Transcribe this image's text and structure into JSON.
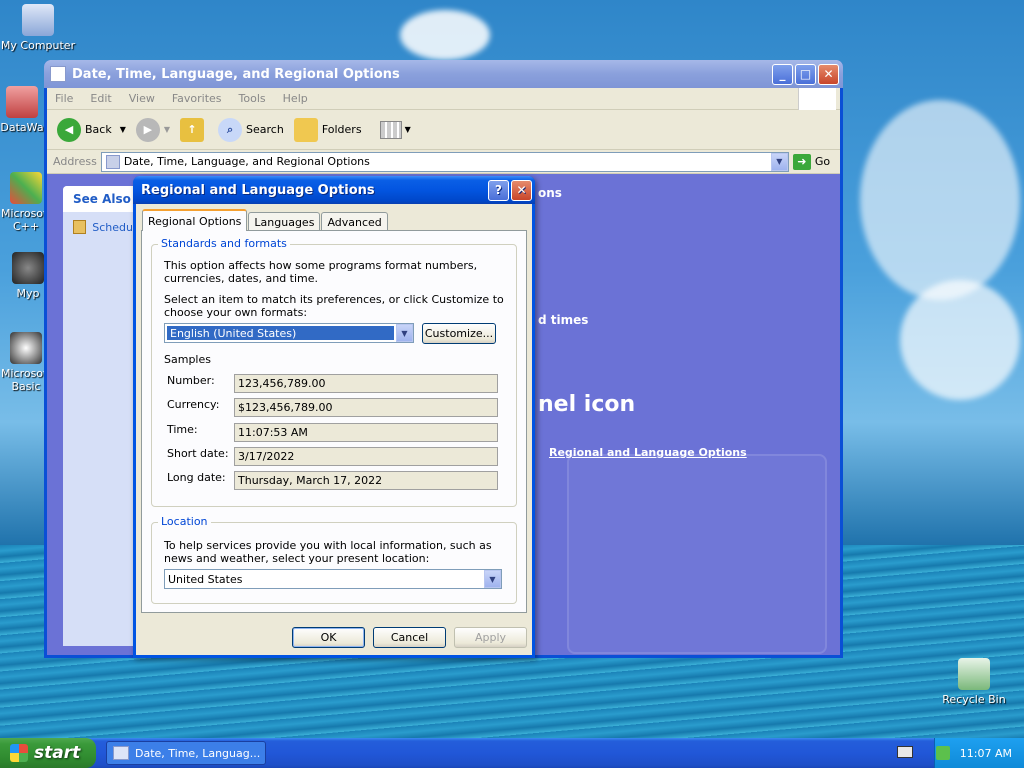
{
  "desktop": {
    "icons": [
      {
        "label": "My Computer"
      },
      {
        "label": "DataWa"
      },
      {
        "label": "Microsoft C++"
      },
      {
        "label": "Myp"
      },
      {
        "label": "Microsoft Basic"
      },
      {
        "label": "Recycle Bin"
      }
    ]
  },
  "explorer": {
    "title": "Date, Time, Language, and Regional Options",
    "menu": [
      "File",
      "Edit",
      "View",
      "Favorites",
      "Tools",
      "Help"
    ],
    "toolbar": {
      "back": "Back",
      "search": "Search",
      "folders": "Folders"
    },
    "address": {
      "label": "Address",
      "value": "Date, Time, Language, and Regional Options",
      "go": "Go"
    },
    "see_also": {
      "heading": "See Also",
      "item": "Schedu"
    },
    "partial_texts": {
      "heading": "ons",
      "task": "d times",
      "pick": "nel icon",
      "link": "Regional and Language Options"
    }
  },
  "dialog": {
    "title": "Regional and Language Options",
    "tabs": [
      "Regional Options",
      "Languages",
      "Advanced"
    ],
    "standards": {
      "group_label": "Standards and formats",
      "desc": "This option affects how some programs format numbers, currencies, dates, and time.",
      "select_desc": "Select an item to match its preferences, or click Customize to choose your own formats:",
      "selected_format": "English (United States)",
      "customize": "Customize...",
      "samples_label": "Samples",
      "samples": [
        {
          "label": "Number:",
          "value": "123,456,789.00"
        },
        {
          "label": "Currency:",
          "value": "$123,456,789.00"
        },
        {
          "label": "Time:",
          "value": "11:07:53 AM"
        },
        {
          "label": "Short date:",
          "value": "3/17/2022"
        },
        {
          "label": "Long date:",
          "value": "Thursday, March 17, 2022"
        }
      ]
    },
    "location": {
      "group_label": "Location",
      "desc": "To help services provide you with local information, such as news and weather, select your present location:",
      "value": "United States"
    },
    "buttons": {
      "ok": "OK",
      "cancel": "Cancel",
      "apply": "Apply"
    }
  },
  "taskbar": {
    "start": "start",
    "task": "Date, Time, Languag...",
    "clock": "11:07 AM"
  }
}
